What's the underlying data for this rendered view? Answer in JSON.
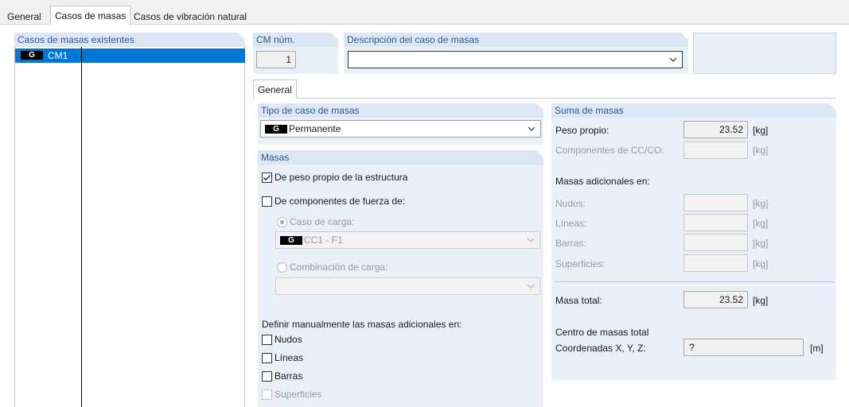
{
  "tabs": [
    "General",
    "Casos de masas",
    "Casos de vibración natural"
  ],
  "left_panel": {
    "header": "Casos de masas existentes",
    "items": [
      {
        "badge": "G",
        "label": "CM1"
      }
    ]
  },
  "cm_num": {
    "label": "CM núm.",
    "value": "1"
  },
  "descripcion": {
    "label": "Descripción del caso de masas",
    "value": ""
  },
  "inner_tab": "General",
  "tipo": {
    "header": "Tipo de caso de masas",
    "badge": "G",
    "value": "Permanente"
  },
  "masas": {
    "header": "Masas",
    "peso_propio": "De peso propio de la estructura",
    "componentes": "De componentes de fuerza de:",
    "caso_carga": "Caso de carga:",
    "caso_carga_value": {
      "badge": "G",
      "value": "CC1 - F1"
    },
    "combinacion": "Combinación de carga:",
    "definir": "Definir manualmente las masas adicionales en:",
    "nudos": "Nudos",
    "lineas": "Líneas",
    "barras": "Barras",
    "superficies": "Superficies"
  },
  "suma": {
    "header": "Suma de masas",
    "peso_propio_label": "Peso propio:",
    "peso_propio_value": "23.52",
    "componentes_label": "Componentes de CC/CO:",
    "adicionales_label": "Masas adicionales en:",
    "nudos_label": "Nudos:",
    "lineas_label": "Líneas:",
    "barras_label": "Barras:",
    "superficies_label": "Superficies:",
    "unit": "[kg]",
    "masa_total_label": "Masa total:",
    "masa_total_value": "23.52",
    "centro_label": "Centro de masas total",
    "coord_label": "Coordenadas X, Y, Z:",
    "coord_value": "?",
    "coord_unit": "[m]"
  }
}
